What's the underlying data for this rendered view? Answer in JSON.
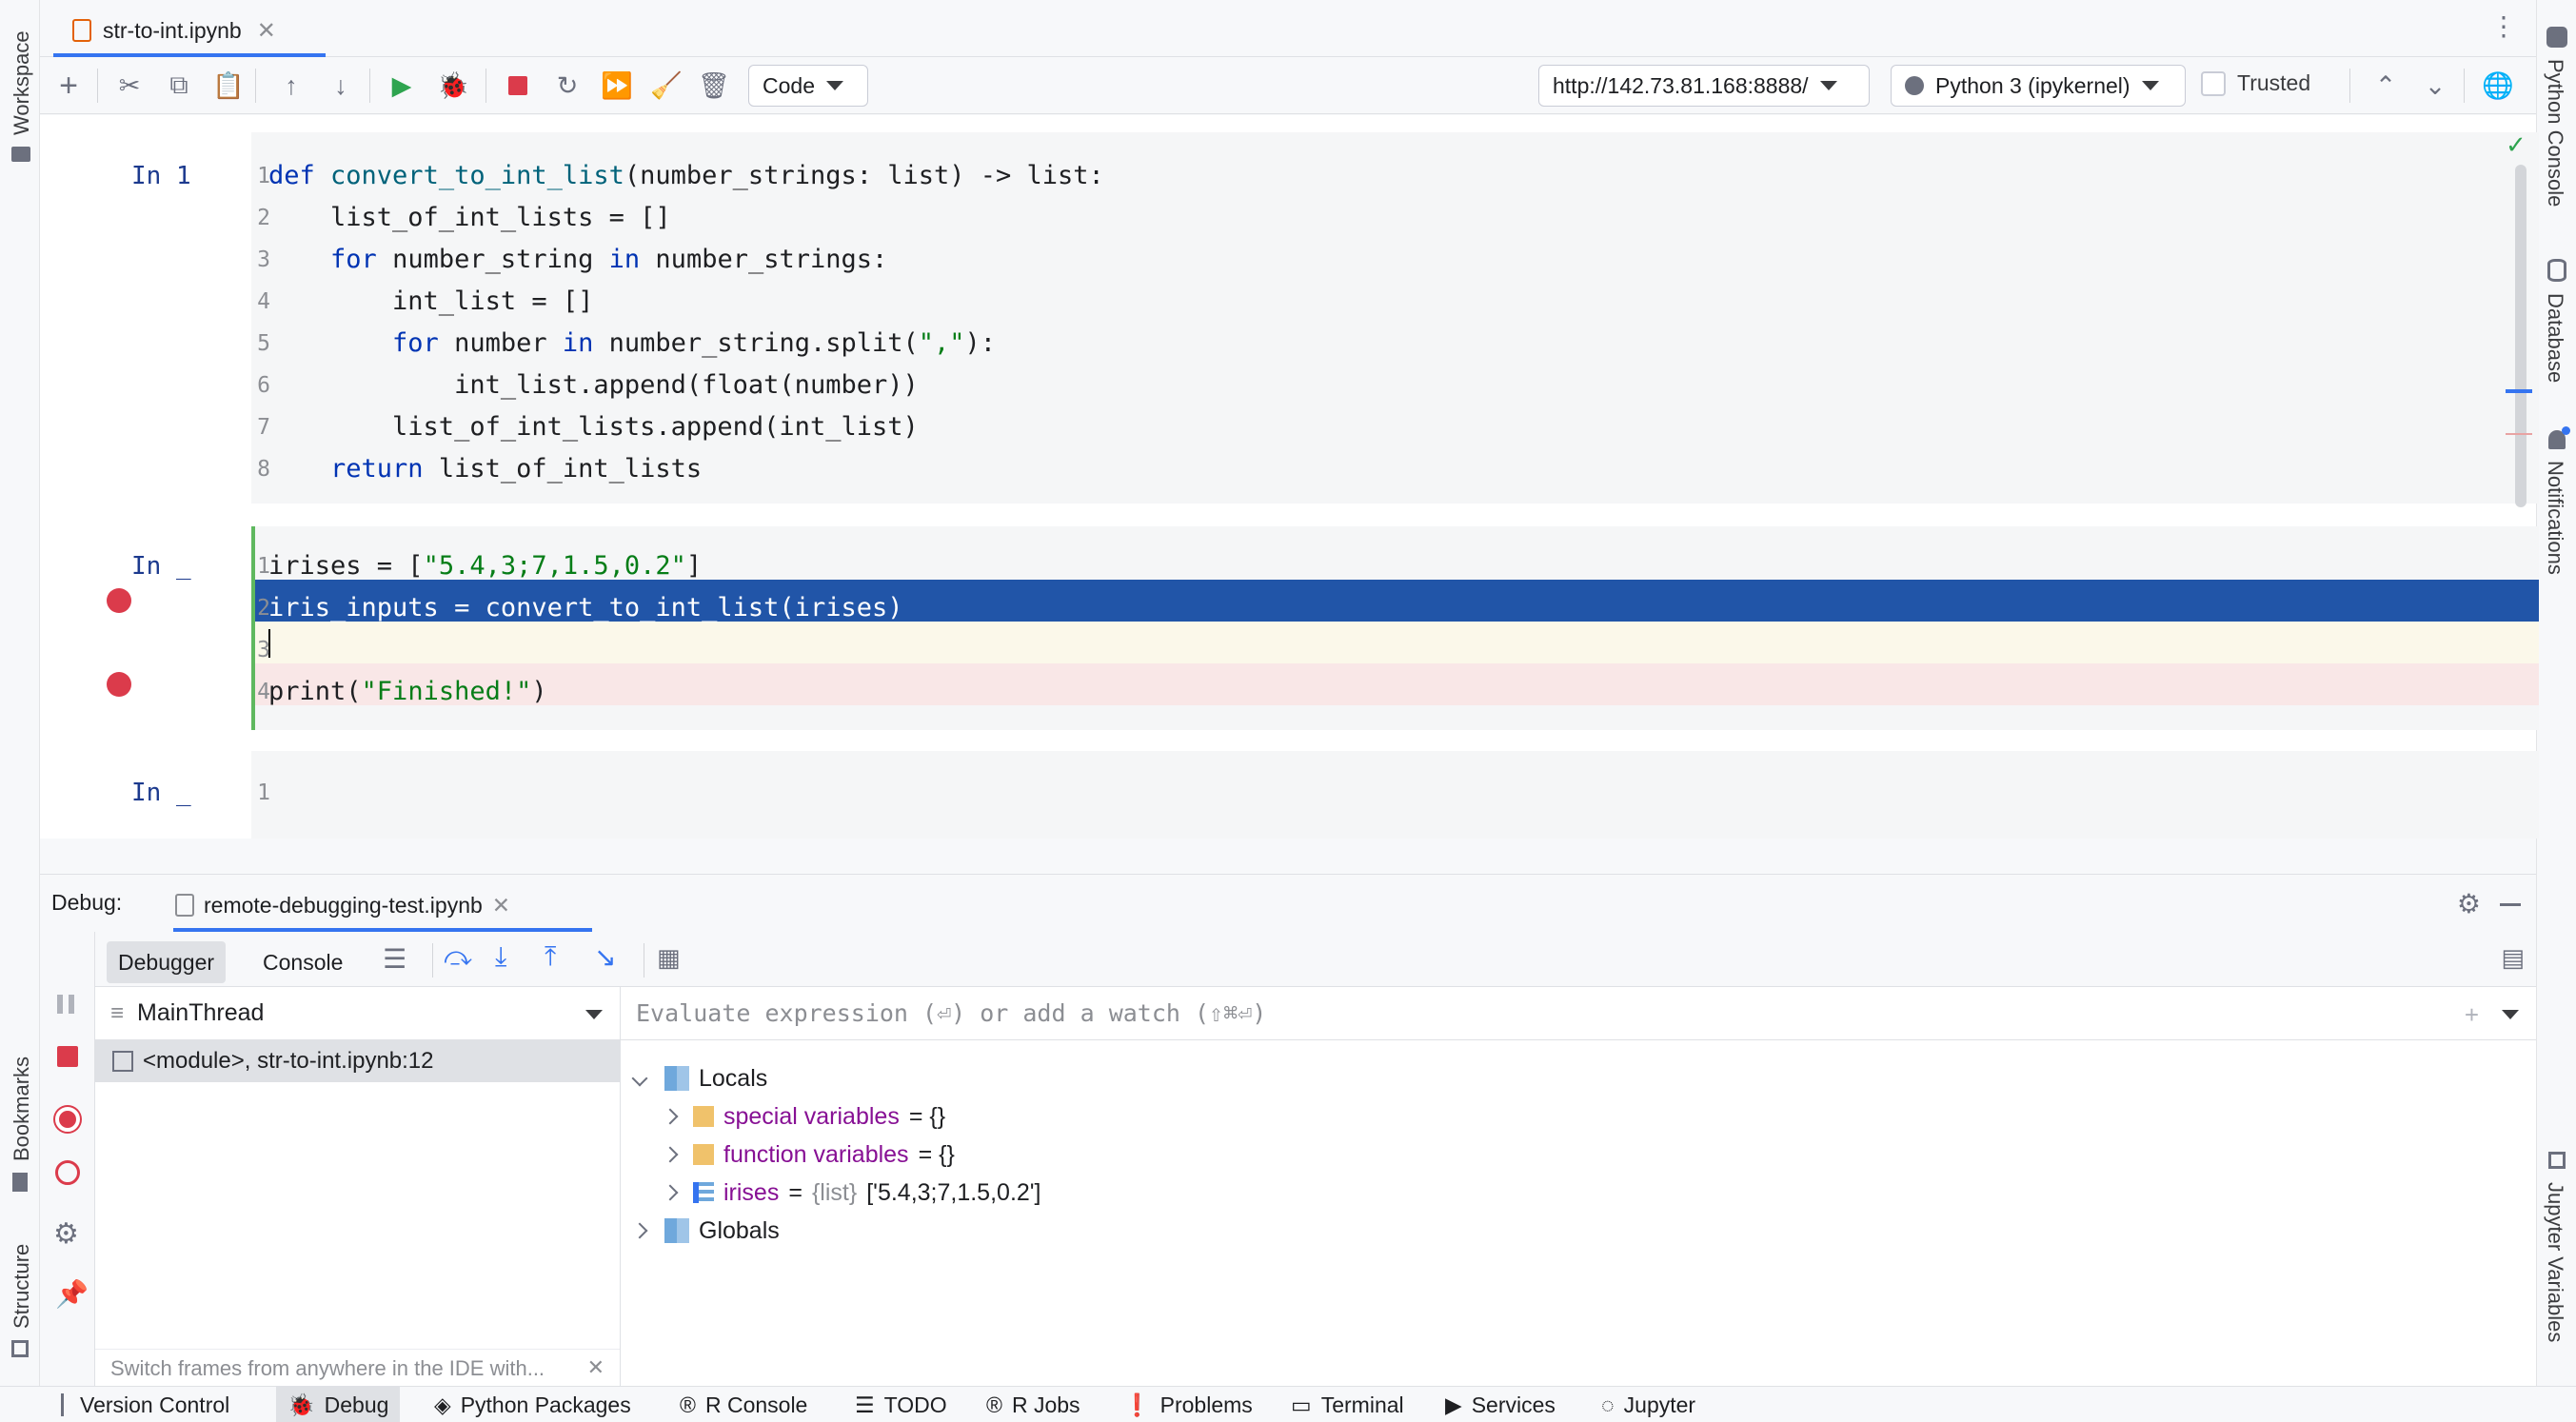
{
  "tab": {
    "title": "str-to-int.ipynb"
  },
  "toolbar": {
    "cell_type": "Code",
    "server_url": "http://142.73.81.168:8888/",
    "kernel": "Python 3 (ipykernel)",
    "trusted_label": "Trusted"
  },
  "left_strip": {
    "workspace": "Workspace",
    "bookmarks": "Bookmarks",
    "structure": "Structure"
  },
  "right_strip": {
    "python_console": "Python Console",
    "database": "Database",
    "notifications": "Notifications",
    "jupyter_variables": "Jupyter Variables"
  },
  "cells": [
    {
      "prompt": "In 1",
      "lines": [
        {
          "n": "1",
          "tokens": [
            {
              "t": "def ",
              "c": "kw"
            },
            {
              "t": "convert_to_int_list",
              "c": "fn"
            },
            {
              "t": "(number_strings: list) -> list:",
              "c": ""
            }
          ]
        },
        {
          "n": "2",
          "tokens": [
            {
              "t": "    list_of_int_lists = []",
              "c": ""
            }
          ]
        },
        {
          "n": "3",
          "tokens": [
            {
              "t": "    ",
              "c": ""
            },
            {
              "t": "for",
              "c": "kw"
            },
            {
              "t": " number_string ",
              "c": ""
            },
            {
              "t": "in",
              "c": "kw"
            },
            {
              "t": " number_strings:",
              "c": ""
            }
          ]
        },
        {
          "n": "4",
          "tokens": [
            {
              "t": "        int_list = []",
              "c": ""
            }
          ]
        },
        {
          "n": "5",
          "tokens": [
            {
              "t": "        ",
              "c": ""
            },
            {
              "t": "for",
              "c": "kw"
            },
            {
              "t": " number ",
              "c": ""
            },
            {
              "t": "in",
              "c": "kw"
            },
            {
              "t": " number_string.split(",
              "c": ""
            },
            {
              "t": "\",\"",
              "c": "str"
            },
            {
              "t": "):",
              "c": ""
            }
          ]
        },
        {
          "n": "6",
          "tokens": [
            {
              "t": "            int_list.append(float(number))",
              "c": ""
            }
          ]
        },
        {
          "n": "7",
          "tokens": [
            {
              "t": "        list_of_int_lists.append(int_list)",
              "c": ""
            }
          ]
        },
        {
          "n": "8",
          "tokens": [
            {
              "t": "    ",
              "c": ""
            },
            {
              "t": "return",
              "c": "kw"
            },
            {
              "t": " list_of_int_lists",
              "c": ""
            }
          ]
        }
      ]
    },
    {
      "prompt": "In _",
      "lines": [
        {
          "n": "1",
          "tokens": [
            {
              "t": "irises = [",
              "c": ""
            },
            {
              "t": "\"5.4,3;7,1.5,0.2\"",
              "c": "str"
            },
            {
              "t": "]",
              "c": ""
            }
          ]
        },
        {
          "n": "2",
          "tokens": [
            {
              "t": "iris_inputs = convert_to_int_list(irises)",
              "c": ""
            }
          ]
        },
        {
          "n": "3",
          "tokens": []
        },
        {
          "n": "4",
          "tokens": [
            {
              "t": "print(",
              "c": ""
            },
            {
              "t": "\"Finished!\"",
              "c": "str"
            },
            {
              "t": ")",
              "c": ""
            }
          ]
        }
      ]
    },
    {
      "prompt": "In _",
      "lines": [
        {
          "n": "1",
          "tokens": []
        }
      ]
    }
  ],
  "debug": {
    "label": "Debug:",
    "session_tab": "remote-debugging-test.ipynb",
    "tab_debugger": "Debugger",
    "tab_console": "Console",
    "thread": "MainThread",
    "frame": "<module>, str-to-int.ipynb:12",
    "frames_hint": "Switch frames from anywhere in the IDE with...",
    "eval_placeholder": "Evaluate expression (⏎) or add a watch (⇧⌘⏎)",
    "locals": "Locals",
    "vars": [
      {
        "name": "special variables",
        "value": "= {}"
      },
      {
        "name": "function variables",
        "value": "= {}"
      },
      {
        "name": "irises",
        "type": "{list}",
        "value": "['5.4,3;7,1.5,0.2']"
      }
    ],
    "globals": "Globals"
  },
  "statusbar": [
    "Version Control",
    "Debug",
    "Python Packages",
    "R Console",
    "TODO",
    "R Jobs",
    "Problems",
    "Terminal",
    "Services",
    "Jupyter"
  ]
}
